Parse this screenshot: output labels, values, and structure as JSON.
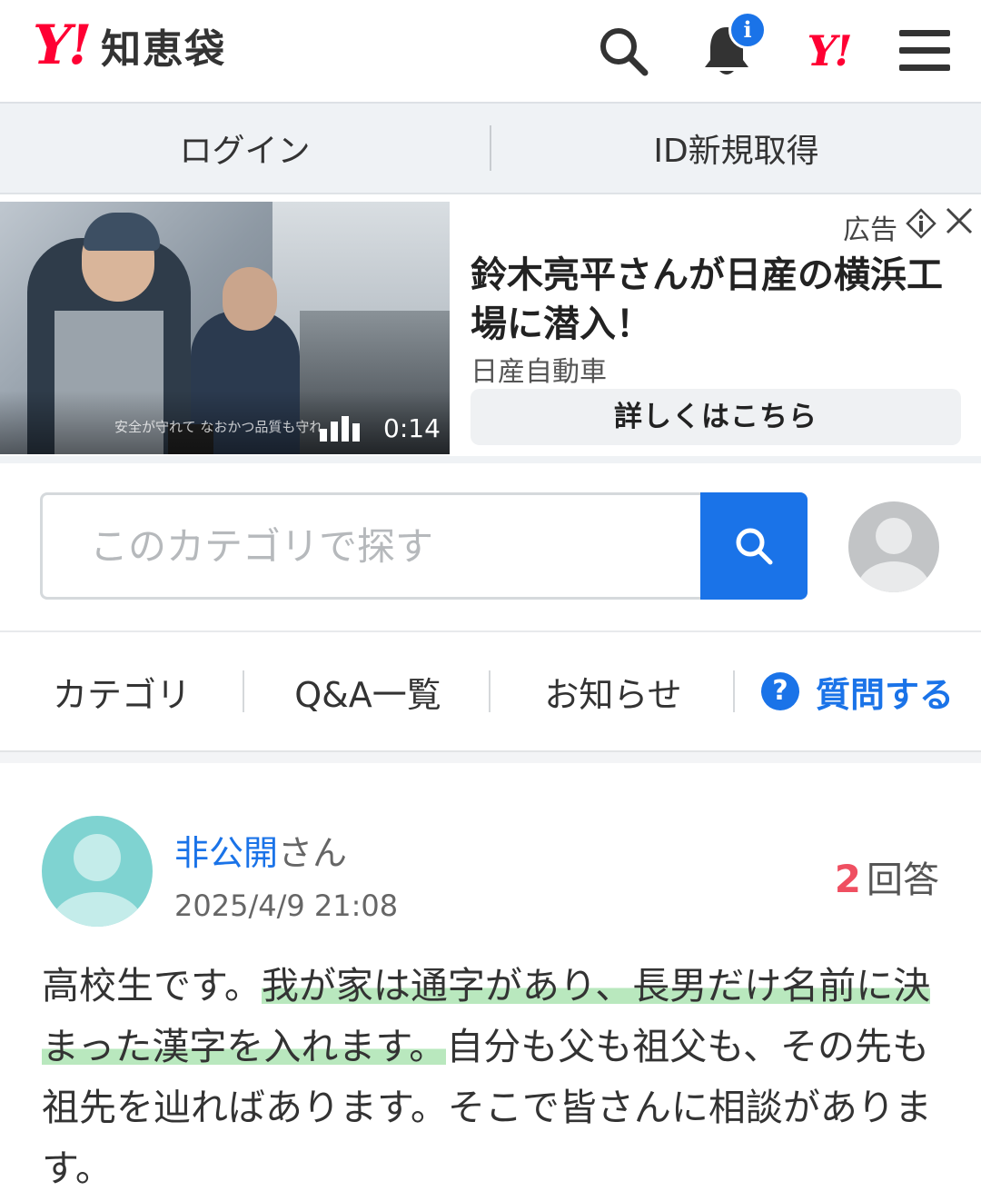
{
  "header": {
    "logo_mark": "Y!",
    "logo_text": "知恵袋",
    "notification_badge": "i",
    "yahoo_mark": "Y!",
    "icons": [
      "search-icon",
      "bell-icon",
      "yahoo-japan-icon",
      "menu-icon"
    ]
  },
  "login_bar": {
    "login": "ログイン",
    "register": "ID新規取得"
  },
  "ad": {
    "label": "広告",
    "title": "鈴木亮平さんが日産の横浜工場に潜入！",
    "source": "日産自動車",
    "cta": "詳しくはこちら",
    "video_duration": "0:14",
    "video_caption": "安全が守れて なおかつ品質も守れ"
  },
  "search": {
    "placeholder": "このカテゴリで探す"
  },
  "nav": {
    "items": [
      "カテゴリ",
      "Q&A一覧",
      "お知らせ"
    ],
    "ask": "質問する",
    "ask_icon_glyph": "?"
  },
  "question": {
    "user_name": "非公開",
    "user_suffix": "さん",
    "date": "2025/4/9 21:08",
    "answer_count": "2",
    "answer_label": "回答",
    "body_part1": "高校生です。",
    "body_highlight": "我が家は通字があり、長男だけ名前に決まった漢字を入れます。",
    "body_part2": "自分も父も祖父も、その先も祖先を辿ればあります。そこで皆さんに相談があります。"
  },
  "colors": {
    "brand_red": "#ff0033",
    "accent_blue": "#1a73e8",
    "answer_count_red": "#ef4f61",
    "highlight_green": "#b9e8be",
    "avatar_teal": "#7fd3d1"
  }
}
